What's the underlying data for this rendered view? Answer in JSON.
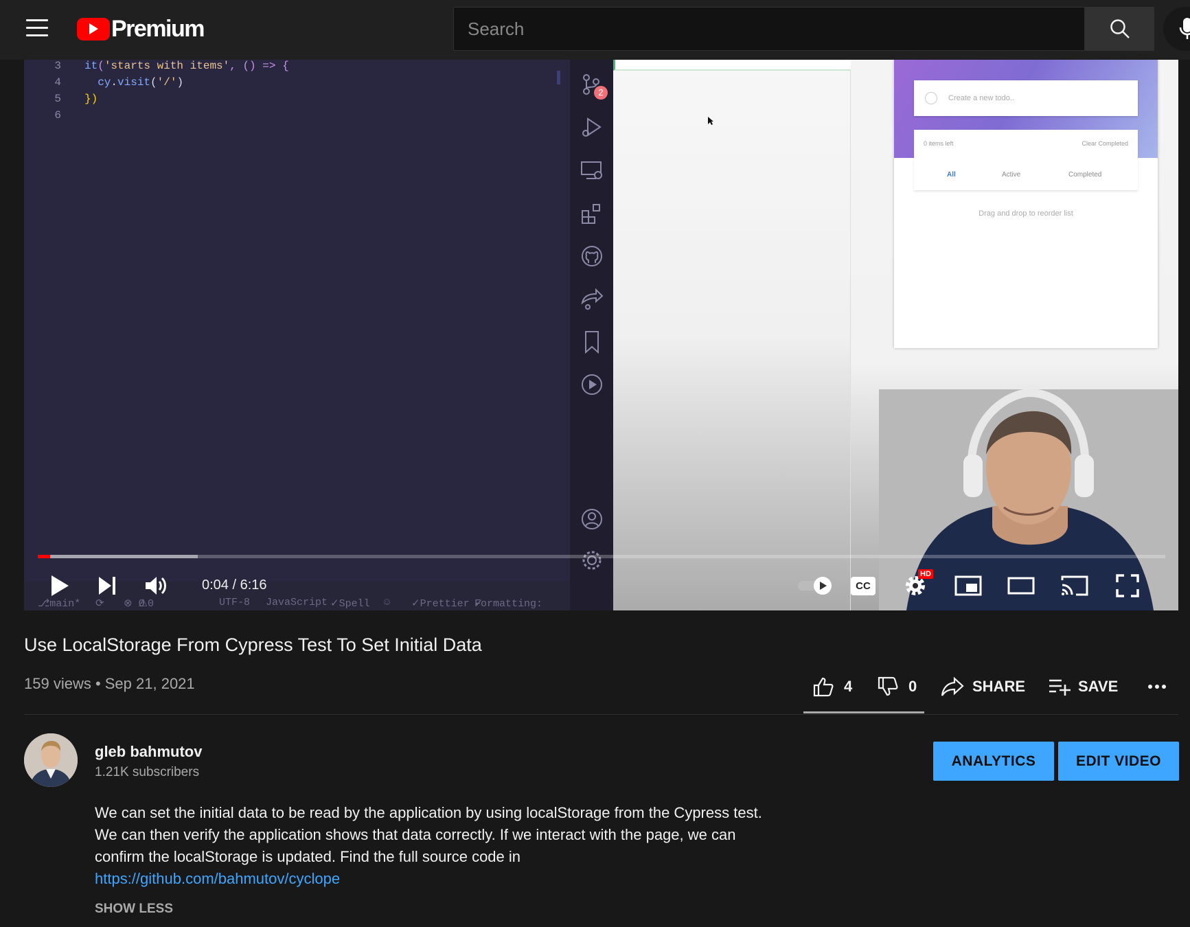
{
  "header": {
    "logo_text": "Premium",
    "search_placeholder": "Search"
  },
  "editor": {
    "lines": [
      {
        "no": "3",
        "code": "it('starts with items', () => {"
      },
      {
        "no": "4",
        "code": "  cy.visit('/')"
      },
      {
        "no": "5",
        "code": "})"
      },
      {
        "no": "6",
        "code": ""
      }
    ],
    "scm_badge": "2",
    "status": {
      "branch": "main*",
      "problems": "0",
      "warnings": "0",
      "encoding": "UTF-8",
      "language": "JavaScript",
      "spell": "Spell",
      "prettier": "Prettier",
      "formatting": "Formatting:"
    }
  },
  "todo_app": {
    "input_placeholder": "Create a new todo..",
    "items_left": "0 items left",
    "clear_completed": "Clear Completed",
    "filters": [
      "All",
      "Active",
      "Completed"
    ],
    "hint": "Drag and drop to reorder list"
  },
  "player": {
    "current_time": "0:04",
    "duration": "6:16",
    "time_display": "0:04 / 6:16",
    "played_fraction": 0.011,
    "buffered_fraction": 0.142,
    "hd_badge": "HD",
    "cc_label": "CC"
  },
  "video": {
    "title": "Use LocalStorage From Cypress Test To Set Initial Data",
    "meta": "159 views • Sep 21, 2021",
    "likes": "4",
    "dislikes": "0",
    "share_label": "SHARE",
    "save_label": "SAVE"
  },
  "channel": {
    "name": "gleb bahmutov",
    "subscribers": "1.21K subscribers",
    "analytics_label": "ANALYTICS",
    "edit_label": "EDIT VIDEO"
  },
  "description": {
    "text": "We can set the initial data to be read by the application by using localStorage from the Cypress test. We can then verify the application shows that data correctly. If we interact with the page, we can confirm the localStorage is updated. Find the full source code in",
    "link": "https://github.com/bahmutov/cyclope",
    "show_less": "SHOW LESS"
  },
  "colors": {
    "accent_red": "#ff0000",
    "link_blue": "#3ea6ff",
    "background": "#181818"
  }
}
